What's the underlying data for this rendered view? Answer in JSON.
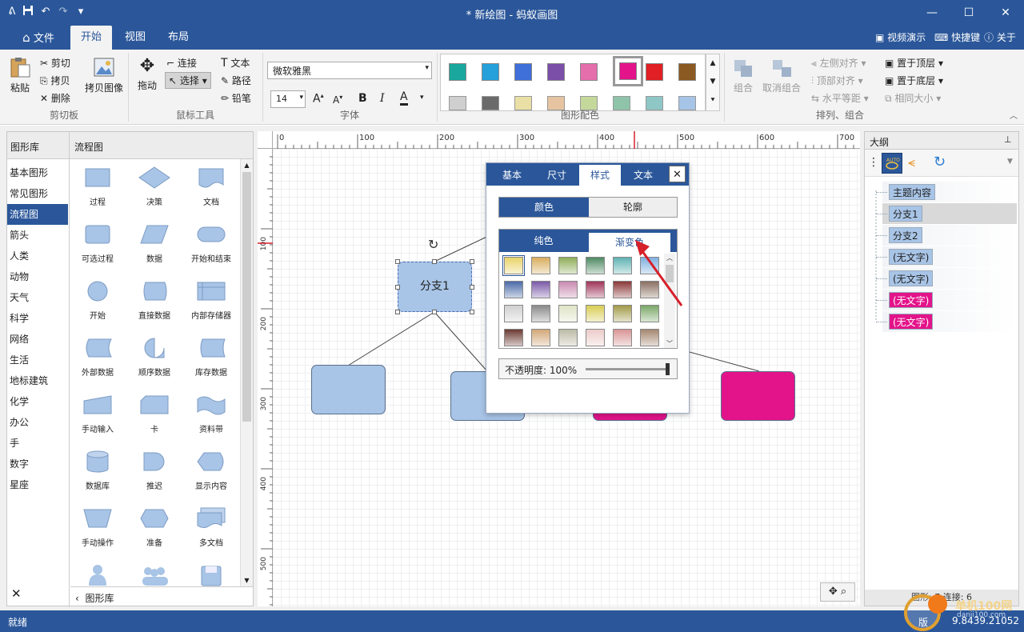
{
  "titlebar": {
    "title": "* 新绘图 - 蚂蚁画图",
    "qa_icons": [
      "app-icon",
      "save-icon",
      "undo-icon",
      "redo-icon",
      "customize-icon"
    ],
    "minimize": "—",
    "maximize": "☐",
    "close": "✕"
  },
  "menu": {
    "tabs": [
      {
        "label": "文件"
      },
      {
        "label": "开始"
      },
      {
        "label": "视图"
      },
      {
        "label": "布局"
      }
    ],
    "video": "视频演示",
    "shortcuts": "快捷键",
    "about": "关于"
  },
  "ribbon": {
    "clipboard": {
      "paste": "粘贴",
      "cut": "剪切",
      "copy": "拷贝",
      "delete": "删除",
      "copy_image": "拷贝图像",
      "group": "剪切板"
    },
    "mouse": {
      "drag": "拖动",
      "connect": "连接",
      "select": "选择",
      "text": "文本",
      "path": "路径",
      "pencil": "铅笔",
      "group": "鼠标工具"
    },
    "font": {
      "name": "微软雅黑",
      "size": "14",
      "group": "字体",
      "grow": "A",
      "shrink": "A",
      "bold": "B",
      "italic": "I",
      "color": "A"
    },
    "colors": {
      "group": "图形配色",
      "row1": [
        "#1aa79d",
        "#26a0da",
        "#3f6fd8",
        "#7b4fa8",
        "#e56ead",
        "#e3148a",
        "#e12025",
        "#8b5a22"
      ],
      "row2": [
        "#cfcfcf",
        "#6a6a6a",
        "#eadfa5",
        "#e6c4a2",
        "#c5d89c",
        "#8fc4aa",
        "#8fc7c6",
        "#a6c4e6"
      ],
      "selected_index": 5
    },
    "arrange": {
      "group": "排列、组合",
      "combine": "组合",
      "uncombine": "取消组合",
      "left_align": "左侧对齐",
      "top_align": "顶部对齐",
      "h_equal": "水平等距",
      "bring_top": "置于顶层",
      "send_bottom": "置于底层",
      "same_size": "相同大小"
    }
  },
  "library": {
    "header_left": "图形库",
    "header_right": "流程图",
    "categories": [
      "基本图形",
      "常见图形",
      "流程图",
      "箭头",
      "人类",
      "动物",
      "天气",
      "科学",
      "网络",
      "生活",
      "地标建筑",
      "化学",
      "办公",
      "手",
      "数字",
      "星座"
    ],
    "selected_category": 2,
    "shapes": [
      "过程",
      "决策",
      "文档",
      "可选过程",
      "数据",
      "开始和结束",
      "开始",
      "直接数据",
      "内部存储器",
      "外部数据",
      "顺序数据",
      "库存数据",
      "手动输入",
      "卡",
      "资料带",
      "数据库",
      "推迟",
      "显示内容",
      "手动操作",
      "准备",
      "多文档"
    ],
    "footer": "图形库",
    "close": "✕"
  },
  "ruler": {
    "h_ticks": [
      "0",
      "100",
      "200",
      "300",
      "400",
      "500",
      "600",
      "700"
    ],
    "v_ticks": [
      "100",
      "200",
      "300",
      "400",
      "500"
    ]
  },
  "diagram": {
    "selected_node": "分支1"
  },
  "style_popup": {
    "tabs": [
      "基本",
      "尺寸",
      "样式",
      "文本"
    ],
    "active_tab": 2,
    "close": "✕",
    "fill_mode": [
      "颜色",
      "轮廓"
    ],
    "fill_type": [
      "纯色",
      "渐变色"
    ],
    "opacity_label": "不透明度: 100%",
    "opacity": 1.0,
    "gradients": [
      [
        "#e9d46a",
        "#d9ae5e",
        "#8fae5a",
        "#4f8a63",
        "#5fb2b3",
        "#7fb0e0"
      ],
      [
        "#4a6aa8",
        "#7b5aa8",
        "#c98ab0",
        "#a0355a",
        "#8b3838",
        "#8b7062"
      ],
      [
        "#d0d0d0",
        "#8a8a8a",
        "#dfe4c6",
        "#d9cd55",
        "#a29a4a",
        "#7aa867"
      ],
      [
        "#6a3b32",
        "#d2a878",
        "#bcbba6",
        "#ecccc9",
        "#d89595",
        "#a58770"
      ]
    ]
  },
  "outline": {
    "title": "大纲",
    "pin": "📌",
    "items": [
      {
        "label": "主题内容",
        "color": "#a8c4e6"
      },
      {
        "label": "分支1",
        "color": "#a8c4e6"
      },
      {
        "label": "分支2",
        "color": "#a8c4e6"
      },
      {
        "label": "(无文字)",
        "color": "#a8c4e6"
      },
      {
        "label": "(无文字)",
        "color": "#a8c4e6"
      },
      {
        "label": "(无文字)",
        "color": "#e3148a"
      },
      {
        "label": "(无文字)",
        "color": "#e3148a"
      }
    ],
    "selected_index": 1,
    "stats": "图形: 7    连接: 6"
  },
  "status": {
    "left": "就绪",
    "version_prefix": "版",
    "version": "9.8439.21052",
    "watermark": "单机100网",
    "watermark_url": "danji100.com"
  }
}
